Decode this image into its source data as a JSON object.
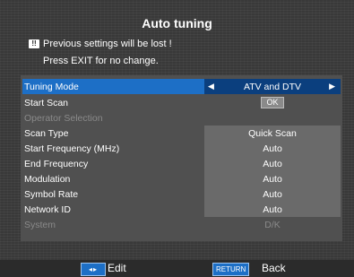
{
  "title": "Auto tuning",
  "warning": {
    "icon": "!!",
    "line1": "Previous settings will be lost !",
    "line2": "Press EXIT for no change."
  },
  "rows": [
    {
      "label": "Tuning Mode",
      "value": "ATV and DTV"
    },
    {
      "label": "Start Scan",
      "value": "OK"
    },
    {
      "label": "Operator Selection",
      "value": ""
    },
    {
      "label": "Scan Type",
      "value": "Quick Scan"
    },
    {
      "label": "Start Frequency (MHz)",
      "value": "Auto"
    },
    {
      "label": "End Frequency",
      "value": "Auto"
    },
    {
      "label": "Modulation",
      "value": "Auto"
    },
    {
      "label": "Symbol Rate",
      "value": "Auto"
    },
    {
      "label": "Network ID",
      "value": "Auto"
    },
    {
      "label": "System",
      "value": "D/K"
    }
  ],
  "footer": {
    "edit_label": "Edit",
    "return_badge": "RETURN",
    "back_label": "Back"
  },
  "colors": {
    "highlight": "#1d6fc6",
    "highlight_value": "#0b3f7e",
    "value_bg": "#6a6a6a"
  }
}
